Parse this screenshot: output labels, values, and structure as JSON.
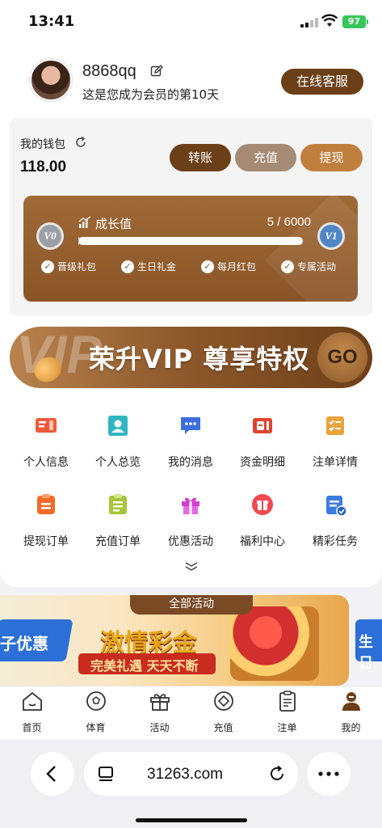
{
  "status_bar": {
    "time": "13:41",
    "battery": "97"
  },
  "profile": {
    "username": "8868qq",
    "member_days": "这是您成为会员的第10天",
    "service_label": "在线客服"
  },
  "wallet": {
    "label": "我的钱包",
    "balance": "118.00",
    "buttons": {
      "transfer": "转账",
      "deposit": "充值",
      "withdraw": "提现"
    }
  },
  "growth": {
    "title": "成长值",
    "current": 5,
    "target": 6000,
    "progress_text": "5 / 6000",
    "vip_badge": "V0",
    "next_badge": "V1",
    "perks": [
      "晋级礼包",
      "生日礼金",
      "每月红包",
      "专属活动"
    ]
  },
  "vip_banner": {
    "watermark": "VIP",
    "slogan": "荣升VIP 尊享特权",
    "go_label": "GO"
  },
  "menu": [
    {
      "label": "个人信息",
      "icon": "id-card-icon",
      "color": "#f05a3a"
    },
    {
      "label": "个人总览",
      "icon": "user-overview-icon",
      "color": "#2fb6c4"
    },
    {
      "label": "我的消息",
      "icon": "message-icon",
      "color": "#3b6fe0"
    },
    {
      "label": "资金明细",
      "icon": "ledger-icon",
      "color": "#e0442f"
    },
    {
      "label": "注单详情",
      "icon": "checklist-icon",
      "color": "#e8a33a"
    },
    {
      "label": "提现订单",
      "icon": "withdraw-order-icon",
      "color": "#f26b2a"
    },
    {
      "label": "充值订单",
      "icon": "deposit-order-icon",
      "color": "#a6c53a"
    },
    {
      "label": "优惠活动",
      "icon": "gift-icon",
      "color": "#d23fd0"
    },
    {
      "label": "福利中心",
      "icon": "welfare-icon",
      "color": "#f0494e"
    },
    {
      "label": "精彩任务",
      "icon": "task-icon",
      "color": "#3b7be0"
    }
  ],
  "activity": {
    "tab_label": "全部活动",
    "left_text": "子优惠",
    "title": "激情彩金",
    "ribbon": "完美礼遇  天天不断",
    "right_text": "生日"
  },
  "tabbar": [
    {
      "label": "首页",
      "icon": "home-icon"
    },
    {
      "label": "体育",
      "icon": "ball-icon"
    },
    {
      "label": "活动",
      "icon": "gift-icon"
    },
    {
      "label": "充值",
      "icon": "deposit-icon"
    },
    {
      "label": "注单",
      "icon": "clipboard-icon"
    },
    {
      "label": "我的",
      "icon": "profile-icon",
      "active": true
    }
  ],
  "browser": {
    "url": "31263.com"
  }
}
